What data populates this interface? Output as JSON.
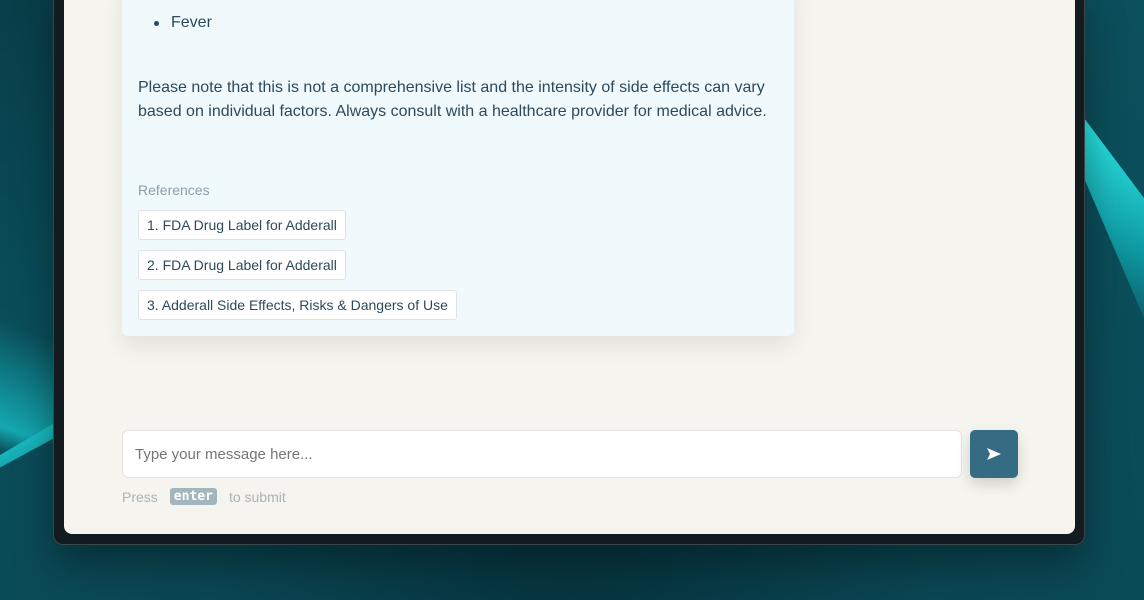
{
  "message": {
    "bullet_items": [
      "Fever"
    ],
    "note": "Please note that this is not a comprehensive list and the intensity of side effects can vary based on individual factors. Always consult with a healthcare provider for medical advice.",
    "references_label": "References",
    "references": [
      "1. FDA Drug Label for Adderall",
      "2. FDA Drug Label for Adderall",
      "3. Adderall Side Effects, Risks & Dangers of Use"
    ]
  },
  "composer": {
    "placeholder": "Type your message here...",
    "send_icon": "send-icon",
    "hint_before": "Press",
    "hint_key": "enter",
    "hint_after": "to submit"
  },
  "colors": {
    "accent": "#356c84",
    "card_bg": "#f0f9fc",
    "text": "#2c4a5c",
    "background": "#0b505d"
  }
}
